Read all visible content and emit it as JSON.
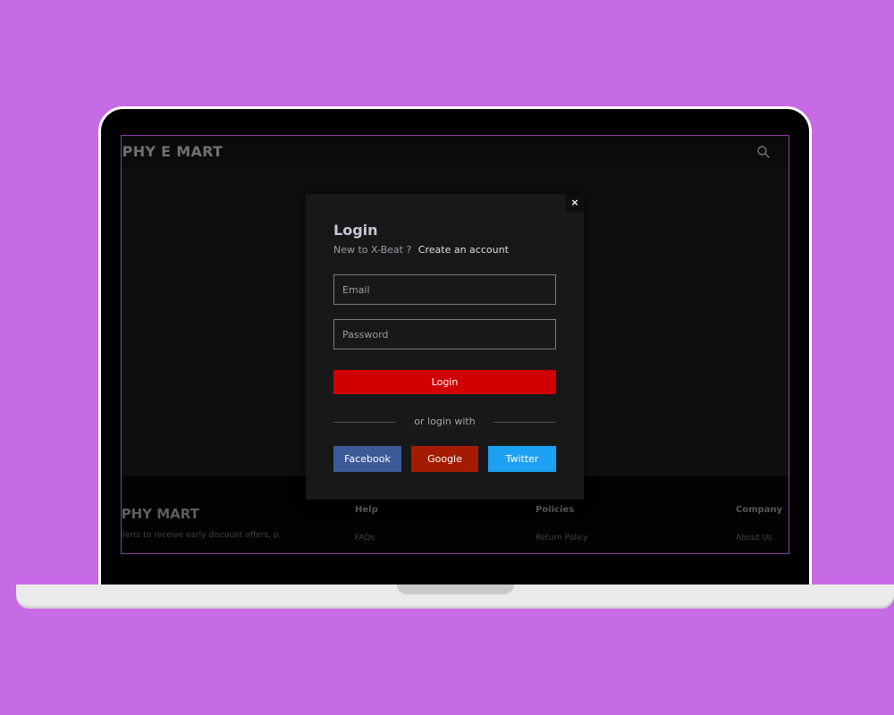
{
  "site": {
    "brand": "APHY E MART"
  },
  "footer": {
    "brand": "APHY MART",
    "tagline": "il alerts to receive early discount offers, p.",
    "columns": [
      {
        "heading": "Help",
        "link": "FAQs"
      },
      {
        "heading": "Policies",
        "link": "Return Policy"
      },
      {
        "heading": "Company",
        "link": "About Us"
      }
    ]
  },
  "modal": {
    "close_label": "×",
    "title": "Login",
    "signup_prompt": "New to X-Beat ?",
    "signup_link": "Create an account",
    "email_placeholder": "Email",
    "password_placeholder": "Password",
    "login_label": "Login",
    "divider_text": "or login with",
    "social": {
      "facebook": "Facebook",
      "google": "Google",
      "twitter": "Twitter"
    }
  },
  "colors": {
    "background": "#c76ae6",
    "login_button": "#d00000",
    "facebook": "#3d5a98",
    "google": "#a41c00",
    "twitter": "#1da1f2"
  },
  "icons": {
    "search": "search-icon",
    "close": "close-icon"
  }
}
